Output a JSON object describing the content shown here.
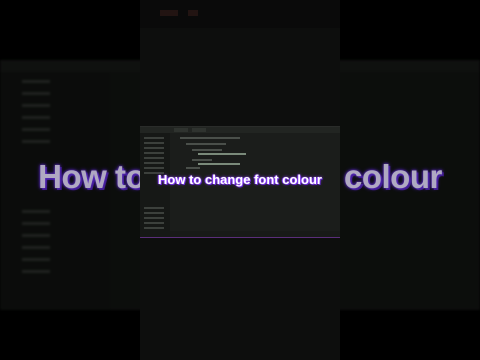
{
  "video": {
    "caption": "How to change font colour",
    "background_caption": "How to change font colour"
  },
  "colors": {
    "caption_text": "#ffffff",
    "caption_glow": "#8a3dff",
    "editor_bg": "#1b1d1b",
    "page_bg": "#000000"
  },
  "icons": [
    "editor-window-icon"
  ]
}
